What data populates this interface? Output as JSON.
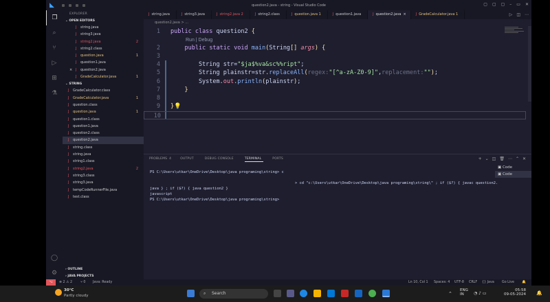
{
  "window": {
    "title": "question2.java - string - Visual Studio Code"
  },
  "explorer": {
    "title": "EXPLORER",
    "open_editors_label": "OPEN EDITORS",
    "open_editors": [
      {
        "name": "string.java",
        "color": "#ccc",
        "badge": ""
      },
      {
        "name": "string3.java",
        "color": "#ccc",
        "badge": ""
      },
      {
        "name": "string2.java",
        "color": "#e0565b",
        "badge": "2"
      },
      {
        "name": "string2.class",
        "color": "#ccc",
        "badge": ""
      },
      {
        "name": "question.java",
        "color": "#e3c07a",
        "badge": "1"
      },
      {
        "name": "question1.java",
        "color": "#ccc",
        "badge": ""
      },
      {
        "name": "question2.java",
        "color": "#ccc",
        "badge": "",
        "close": "×"
      },
      {
        "name": "GradeCalculator.java",
        "color": "#e3c07a",
        "badge": "1"
      }
    ],
    "folder_label": "STRING",
    "files": [
      {
        "name": "GradeCalculator.class",
        "color": "#ccc",
        "badge": ""
      },
      {
        "name": "GradeCalculator.java",
        "color": "#e3c07a",
        "badge": "1"
      },
      {
        "name": "question.class",
        "color": "#ccc",
        "badge": ""
      },
      {
        "name": "question.java",
        "color": "#e3c07a",
        "badge": "1"
      },
      {
        "name": "question1.class",
        "color": "#ccc",
        "badge": ""
      },
      {
        "name": "question1.java",
        "color": "#ccc",
        "badge": ""
      },
      {
        "name": "question2.class",
        "color": "#ccc",
        "badge": ""
      },
      {
        "name": "question2.java",
        "color": "#ccc",
        "badge": "",
        "active": true
      },
      {
        "name": "string.class",
        "color": "#ccc",
        "badge": ""
      },
      {
        "name": "string.java",
        "color": "#ccc",
        "badge": ""
      },
      {
        "name": "string1.class",
        "color": "#ccc",
        "badge": ""
      },
      {
        "name": "string2.java",
        "color": "#e0565b",
        "badge": "2"
      },
      {
        "name": "string3.class",
        "color": "#ccc",
        "badge": ""
      },
      {
        "name": "string3.java",
        "color": "#ccc",
        "badge": ""
      },
      {
        "name": "tempCodeRunnerFile.java",
        "color": "#ccc",
        "badge": ""
      },
      {
        "name": "test.class",
        "color": "#ccc",
        "badge": ""
      }
    ],
    "outline_label": "OUTLINE",
    "java_projects_label": "JAVA PROJECTS"
  },
  "tabs": [
    {
      "label": "string.java",
      "color": "#ccc",
      "badge": ""
    },
    {
      "label": "string3.java",
      "color": "#ccc",
      "badge": ""
    },
    {
      "label": "string2.java 2",
      "color": "#e0565b",
      "badge": ""
    },
    {
      "label": "string2.class",
      "color": "#ccc",
      "badge": ""
    },
    {
      "label": "question.java 1",
      "color": "#e3c07a",
      "badge": ""
    },
    {
      "label": "question1.java",
      "color": "#ccc",
      "badge": ""
    },
    {
      "label": "question2.java",
      "color": "#ddd",
      "badge": "×",
      "active": true
    },
    {
      "label": "GradeCalculator.java 1",
      "color": "#e3c07a",
      "badge": ""
    }
  ],
  "breadcrumb": "question2.java > ...",
  "editor": {
    "codelens": "Run | Debug",
    "lines": [
      {
        "n": "1",
        "tokens": [
          [
            "kw",
            "public "
          ],
          [
            "kw",
            "class "
          ],
          [
            "plain",
            "question2 "
          ],
          [
            "br",
            "{"
          ]
        ]
      },
      {
        "n": "2",
        "tokens": [
          [
            "plain",
            "    "
          ],
          [
            "kw",
            "public "
          ],
          [
            "kw",
            "static "
          ],
          [
            "kw",
            "void "
          ],
          [
            "fn",
            "main"
          ],
          [
            "br",
            "("
          ],
          [
            "plain",
            "String"
          ],
          [
            "br",
            "[] "
          ],
          [
            "par",
            "args"
          ],
          [
            "br",
            ") {"
          ]
        ]
      },
      {
        "n": "3",
        "tokens": []
      },
      {
        "n": "4",
        "tokens": [
          [
            "plain",
            "        String str="
          ],
          [
            "str",
            "\"$ja$%va&sc%%ript\""
          ],
          [
            "plain",
            ";"
          ]
        ]
      },
      {
        "n": "5",
        "tokens": [
          [
            "plain",
            "        String plainstr=str."
          ],
          [
            "fn",
            "replaceAll"
          ],
          [
            "br",
            "("
          ],
          [
            "hint",
            "regex:"
          ],
          [
            "str",
            "\"[^a-zA-Z0-9]\""
          ],
          [
            "plain",
            ","
          ],
          [
            "hint",
            "replacement:"
          ],
          [
            "str",
            "\"\""
          ],
          [
            "br",
            ")"
          ],
          [
            "plain",
            ";"
          ]
        ]
      },
      {
        "n": "6",
        "tokens": [
          [
            "plain",
            "        System."
          ],
          [
            "field",
            "out"
          ],
          [
            "plain",
            "."
          ],
          [
            "fn",
            "println"
          ],
          [
            "br",
            "("
          ],
          [
            "plain",
            "plainstr"
          ],
          [
            "br",
            ")"
          ],
          [
            "plain",
            ";"
          ]
        ]
      },
      {
        "n": "7",
        "tokens": [
          [
            "plain",
            "    "
          ],
          [
            "br",
            "}"
          ]
        ]
      },
      {
        "n": "8",
        "tokens": []
      },
      {
        "n": "9",
        "tokens": [
          [
            "br",
            "}"
          ],
          [
            "plain",
            "💡"
          ]
        ]
      },
      {
        "n": "10",
        "tokens": []
      }
    ]
  },
  "panel": {
    "tabs": [
      {
        "label": "PROBLEMS",
        "count": "4"
      },
      {
        "label": "OUTPUT",
        "count": ""
      },
      {
        "label": "DEBUG CONSOLE",
        "count": ""
      },
      {
        "label": "TERMINAL",
        "count": "",
        "active": true
      },
      {
        "label": "PORTS",
        "count": ""
      }
    ],
    "terminal_lines": [
      "PS C:\\Users\\utkar\\OneDrive\\Desktop\\java programing\\string> c",
      "                                                                 > cd \"c:\\Users\\utkar\\OneDrive\\Desktop\\java programing\\string\\\" ; if ($?) { javac question2.",
      "java } ; if ($?) { java question2 }",
      "javascript",
      "PS C:\\Users\\utkar\\OneDrive\\Desktop\\java programing\\string>"
    ],
    "terminal_list": [
      "Code",
      "Code"
    ]
  },
  "statusbar": {
    "remote": "⌥",
    "problems": "⊗ 2 ⚠ 2",
    "ports": "⑂ 0",
    "java": "Java: Ready",
    "position": "Ln 10, Col 1",
    "spaces": "Spaces: 4",
    "encoding": "UTF-8",
    "eol": "CRLF",
    "language": "{} Java",
    "golive": "Go Live"
  },
  "taskbar": {
    "temperature": "30°C",
    "weather": "Partly cloudy",
    "search_placeholder": "Search",
    "lang1": "ENG",
    "lang2": "IN",
    "time": "05:58",
    "date": "09-05-2024"
  }
}
